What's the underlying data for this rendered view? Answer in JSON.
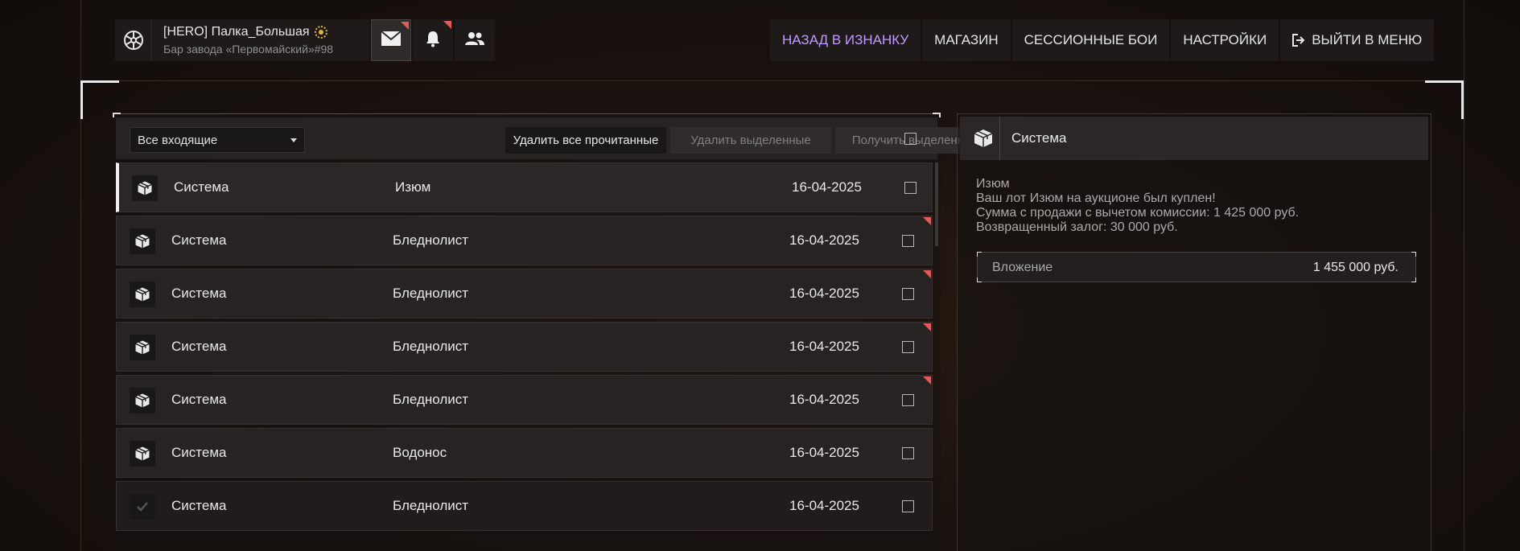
{
  "profile": {
    "nickname": "[HERO] Палка_Большая",
    "location": "Бар завода «Первомайский»#98",
    "logo_icon": "radiation-logo-icon",
    "rank_badge": "sun-badge-icon"
  },
  "top_icons": [
    {
      "name": "mail-icon",
      "unread": true,
      "active": true
    },
    {
      "name": "bell-icon",
      "unread": true,
      "active": false
    },
    {
      "name": "friends-icon",
      "unread": false,
      "active": false
    }
  ],
  "nav": {
    "back_label": "НАЗАД В ИЗНАНКУ",
    "shop_label": "МАГАЗИН",
    "sessions_label": "СЕССИОННЫЕ БОИ",
    "settings_label": "НАСТРОЙКИ",
    "exit_label": "ВЫЙТИ В МЕНЮ",
    "accent_color": "#c19bff"
  },
  "mail_toolbar": {
    "filter_value": "Все входящие",
    "delete_read_label": "Удалить все прочитанные",
    "delete_selected_label": "Удалить выделенные",
    "get_selected_label": "Получить выделенные"
  },
  "mail_list": [
    {
      "sender": "Система",
      "subject": "Изюм",
      "date": "16-04-2025",
      "icon": "package-icon",
      "unread": false,
      "selected": true
    },
    {
      "sender": "Система",
      "subject": "Бледнолист",
      "date": "16-04-2025",
      "icon": "package-icon",
      "unread": true,
      "selected": false
    },
    {
      "sender": "Система",
      "subject": "Бледнолист",
      "date": "16-04-2025",
      "icon": "package-icon",
      "unread": true,
      "selected": false
    },
    {
      "sender": "Система",
      "subject": "Бледнолист",
      "date": "16-04-2025",
      "icon": "package-icon",
      "unread": true,
      "selected": false
    },
    {
      "sender": "Система",
      "subject": "Бледнолист",
      "date": "16-04-2025",
      "icon": "package-icon",
      "unread": true,
      "selected": false
    },
    {
      "sender": "Система",
      "subject": "Водонос",
      "date": "16-04-2025",
      "icon": "package-icon",
      "unread": false,
      "selected": false
    },
    {
      "sender": "Система",
      "subject": "Бледнолист",
      "date": "16-04-2025",
      "icon": "checkmark-icon",
      "unread": false,
      "selected": false
    }
  ],
  "message": {
    "sender": "Система",
    "lines": [
      "Изюм",
      "Ваш лот Изюм на аукционе был куплен!",
      "Сумма с продажи с вычетом комиссии: 1 425 000 руб.",
      "Возвращенный залог: 30 000 руб."
    ],
    "attachment_label": "Вложение",
    "attachment_value": "1 455 000 руб."
  },
  "colors": {
    "unread_marker": "#e05b5b",
    "panel": "#262322",
    "background": "#1a120e"
  }
}
